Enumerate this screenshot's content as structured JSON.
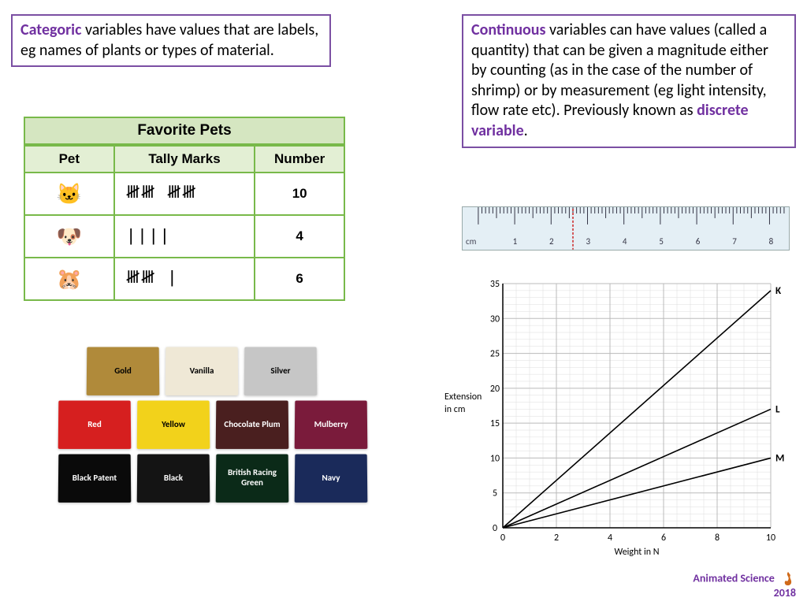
{
  "left_box": {
    "keyword": "Categoric",
    "text": " variables have values that are labels, eg names of plants or types of material."
  },
  "right_box": {
    "keyword": "Continuous",
    "text": " variables can have values (called a quantity) that can be given a magnitude either by counting (as in the case of the number of shrimp) or by measurement (eg light intensity, flow rate etc). Previously known as ",
    "keyword2": "discrete variable",
    "tail": "."
  },
  "pets_table": {
    "title": "Favorite Pets",
    "headers": [
      "Pet",
      "Tally Marks",
      "Number"
    ],
    "rows": [
      {
        "icon": "🐱",
        "tally": "𝍸𝍸 𝍸𝍸",
        "number": "10"
      },
      {
        "icon": "🐶",
        "tally": "||||",
        "number": "4"
      },
      {
        "icon": "🐹",
        "tally": "𝍸𝍸 |",
        "number": "6"
      }
    ]
  },
  "swatches": {
    "row1": [
      {
        "name": "Gold",
        "bg": "#b08a3a",
        "dark": false
      },
      {
        "name": "Vanilla",
        "bg": "#efe8d6",
        "dark": false
      },
      {
        "name": "Silver",
        "bg": "#c6c6c6",
        "dark": false
      }
    ],
    "row2": [
      {
        "name": "Red",
        "bg": "#d61f1f",
        "dark": true
      },
      {
        "name": "Yellow",
        "bg": "#f2d21b",
        "dark": false
      },
      {
        "name": "Chocolate Plum",
        "bg": "#4a1f1f",
        "dark": true
      },
      {
        "name": "Mulberry",
        "bg": "#7a1b3b",
        "dark": true
      }
    ],
    "row3": [
      {
        "name": "Black Patent",
        "bg": "#0a0a0a",
        "dark": true
      },
      {
        "name": "Black",
        "bg": "#141414",
        "dark": true
      },
      {
        "name": "British Racing Green",
        "bg": "#0b2a18",
        "dark": true
      },
      {
        "name": "Navy",
        "bg": "#1a2a5a",
        "dark": true
      }
    ]
  },
  "ruler": {
    "unit": "cm",
    "labels": [
      "1",
      "2",
      "3",
      "4",
      "5",
      "6",
      "7",
      "8"
    ],
    "mark_at": 2.6
  },
  "chart_data": {
    "type": "line",
    "title": "",
    "xlabel": "Weight in N",
    "ylabel": "Extension in cm",
    "xlim": [
      0,
      10
    ],
    "ylim": [
      0,
      35
    ],
    "xticks": [
      0,
      2,
      4,
      6,
      8,
      10
    ],
    "yticks": [
      0,
      5,
      10,
      15,
      20,
      25,
      30,
      35
    ],
    "series": [
      {
        "name": "K",
        "x": [
          0,
          10
        ],
        "y": [
          0,
          34
        ]
      },
      {
        "name": "L",
        "x": [
          0,
          10
        ],
        "y": [
          0,
          17
        ]
      },
      {
        "name": "M",
        "x": [
          0,
          10
        ],
        "y": [
          0,
          10
        ]
      }
    ]
  },
  "footer": {
    "line1": "Animated Science",
    "line2": "2018"
  }
}
